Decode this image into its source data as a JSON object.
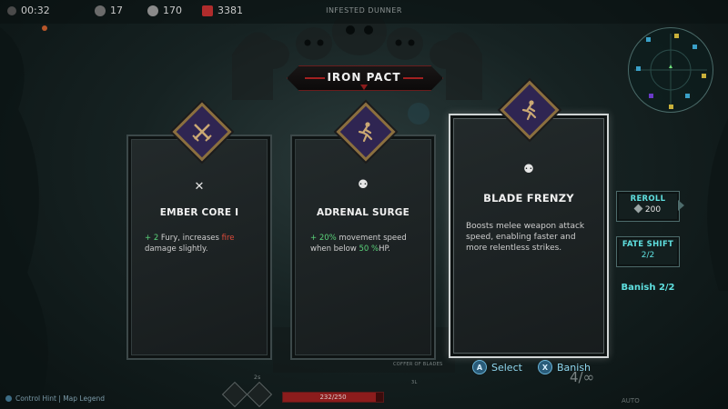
{
  "hud": {
    "timer": "00:32",
    "stat_1": "17",
    "stat_2": "170",
    "stat_3": "3381",
    "zone_name": "INFESTED DUNNER",
    "colors": {
      "stat_1_icon": "#6b6b6b",
      "stat_2_icon": "#8a8a8a",
      "stat_3_icon": "#b02c2c"
    }
  },
  "title": {
    "text": "IRON PACT",
    "accent_color": "#a22020"
  },
  "cards": [
    {
      "icon": "crossed-swords-icon",
      "name": "EMBER CORE I",
      "desc_prefix_green": "+ 2",
      "desc_mid": " Fury, increases ",
      "desc_red": "fire",
      "desc_end": " damage slightly."
    },
    {
      "icon": "runner-icon",
      "name": "ADRENAL SURGE",
      "desc_prefix_green": "+ 20%",
      "desc_mid": " movement speed when below ",
      "desc_green2": "50 %",
      "desc_end": "HP."
    },
    {
      "icon": "runner-icon",
      "name": "BLADE FRENZY",
      "desc": "Boosts melee weapon attack speed, enabling faster and more relentless strikes.",
      "selected": true
    }
  ],
  "side_panel": {
    "reroll_label": "REROLL",
    "reroll_cost": "200",
    "fate_label": "FATE SHIFT",
    "fate_value": "2/2",
    "banish": "Banish 2/2"
  },
  "prompts": {
    "select_button": "A",
    "select_label": "Select",
    "banish_button": "X",
    "banish_label": "Banish"
  },
  "bottom_hud": {
    "hint": "Control Hint | Map Legend",
    "weapon_name": "COFFER OF BLADES",
    "hp_text": "232/250",
    "hp_fraction": 0.93,
    "ammo": "4/∞",
    "mode": "AUTO",
    "skill_charge": "2s",
    "weapon_level": "3L"
  }
}
